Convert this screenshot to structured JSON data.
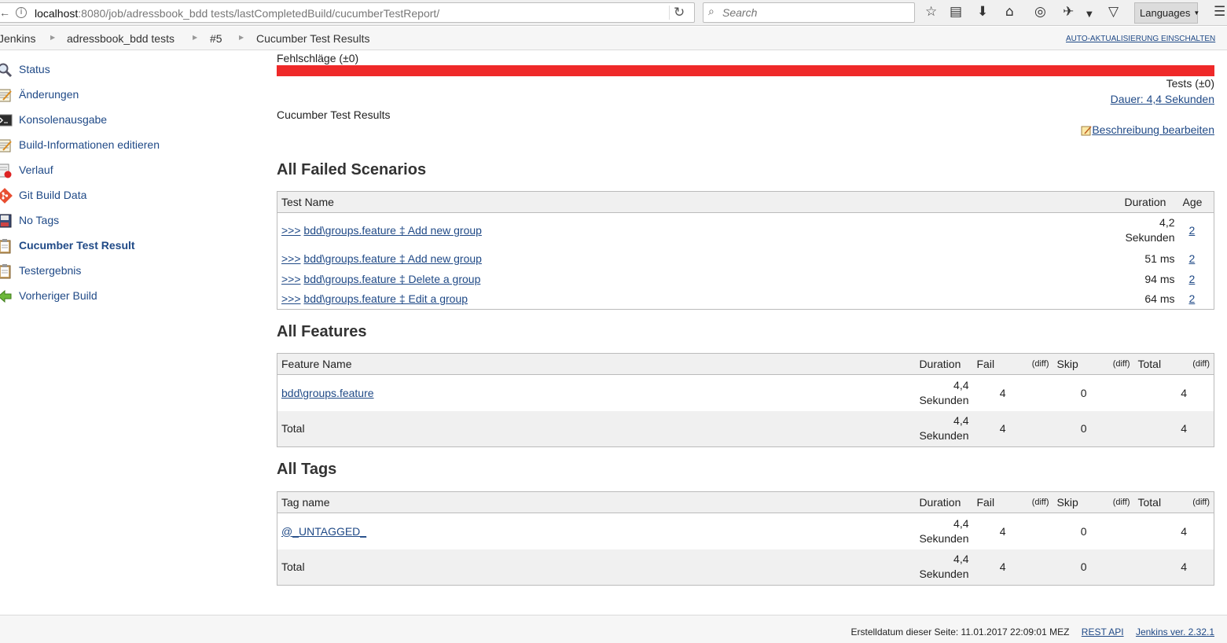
{
  "browser": {
    "url_host": "localhost",
    "url_rest": ":8080/job/adressbook_bdd tests/lastCompletedBuild/cucumberTestReport/",
    "search_placeholder": "Search",
    "languages_label": "Languages"
  },
  "breadcrumb": {
    "items": [
      "Jenkins",
      "adressbook_bdd tests",
      "#5",
      "Cucumber Test Results"
    ],
    "auto_refresh": "AUTO-AKTUALISIERUNG EINSCHALTEN"
  },
  "sidebar": {
    "items": [
      {
        "label": "Status",
        "icon": "search-icon"
      },
      {
        "label": "Änderungen",
        "icon": "notepad-icon"
      },
      {
        "label": "Konsolenausgabe",
        "icon": "terminal-icon"
      },
      {
        "label": "Build-Informationen editieren",
        "icon": "notepad-icon"
      },
      {
        "label": "Verlauf",
        "icon": "delete-document-icon"
      },
      {
        "label": "Git Build Data",
        "icon": "git-icon"
      },
      {
        "label": "No Tags",
        "icon": "save-icon"
      },
      {
        "label": "Cucumber Test Result",
        "icon": "clipboard-icon"
      },
      {
        "label": "Testergebnis",
        "icon": "clipboard-icon"
      },
      {
        "label": "Vorheriger Build",
        "icon": "green-arrow-left-icon"
      }
    ],
    "active_index": 7
  },
  "summary": {
    "fail_label": "Fehlschläge (±0)",
    "fail_fraction": 1.0,
    "fail_color": "#ef2929",
    "tests_label": "Tests (±0)",
    "duration_link": "Dauer: 4,4 Sekunden",
    "description": "Cucumber Test Results",
    "edit_description": "Beschreibung bearbeiten"
  },
  "failed_scenarios": {
    "title": "All Failed Scenarios",
    "headers": [
      "Test Name",
      "Duration",
      "Age"
    ],
    "rows": [
      {
        "prefix": ">>>",
        "name": "bdd\\groups.feature ‡ Add new group",
        "duration_top": "4,2",
        "duration_bottom": "Sekunden",
        "age": "2"
      },
      {
        "prefix": ">>>",
        "name": "bdd\\groups.feature ‡ Add new group",
        "duration_top": "51 ms",
        "duration_bottom": "",
        "age": "2"
      },
      {
        "prefix": ">>>",
        "name": "bdd\\groups.feature ‡ Delete a group",
        "duration_top": "94 ms",
        "duration_bottom": "",
        "age": "2"
      },
      {
        "prefix": ">>>",
        "name": "bdd\\groups.feature ‡ Edit a group",
        "duration_top": "64 ms",
        "duration_bottom": "",
        "age": "2"
      }
    ]
  },
  "features": {
    "title": "All Features",
    "headers": [
      "Feature Name",
      "Duration",
      "Fail",
      "(diff)",
      "Skip",
      "(diff)",
      "Total",
      "(diff)"
    ],
    "rows": [
      {
        "name": "bdd\\groups.feature",
        "duration_top": "4,4",
        "duration_bottom": "Sekunden",
        "fail": "4",
        "skip": "0",
        "total": "4"
      }
    ],
    "total": {
      "name": "Total",
      "duration_top": "4,4",
      "duration_bottom": "Sekunden",
      "fail": "4",
      "skip": "0",
      "total": "4"
    }
  },
  "tags": {
    "title": "All Tags",
    "headers": [
      "Tag name",
      "Duration",
      "Fail",
      "(diff)",
      "Skip",
      "(diff)",
      "Total",
      "(diff)"
    ],
    "rows": [
      {
        "name": "@_UNTAGGED_",
        "duration_top": "4,4",
        "duration_bottom": "Sekunden",
        "fail": "4",
        "skip": "0",
        "total": "4"
      }
    ],
    "total": {
      "name": "Total",
      "duration_top": "4,4",
      "duration_bottom": "Sekunden",
      "fail": "4",
      "skip": "0",
      "total": "4"
    }
  },
  "footer": {
    "generated": "Erstelldatum dieser Seite: 11.01.2017 22:09:01 MEZ",
    "rest_api": "REST API",
    "version": "Jenkins ver. 2.32.1"
  }
}
